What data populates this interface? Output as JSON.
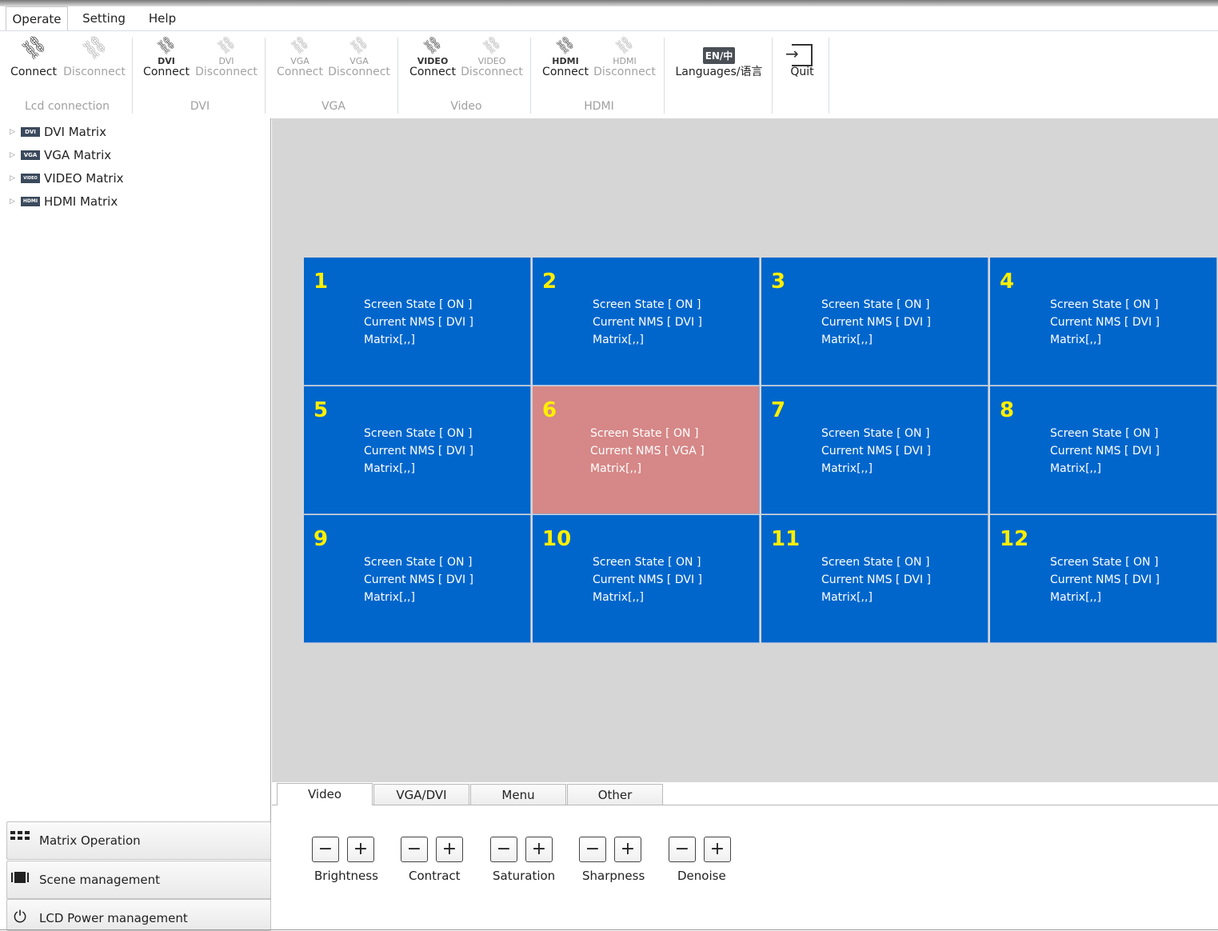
{
  "menubar": {
    "tabs": [
      "Operate",
      "Setting",
      "Help"
    ],
    "active": "Operate"
  },
  "ribbon": {
    "lcd": {
      "connect": "Connect",
      "disconnect": "Disconnect",
      "group": "Lcd connection"
    },
    "dvi": {
      "tag": "DVI",
      "connect": "Connect",
      "disconnect": "Disconnect",
      "group": "DVI"
    },
    "vga": {
      "tag": "VGA",
      "connect": "Connect",
      "disconnect": "Disconnect",
      "group": "VGA"
    },
    "video": {
      "tag": "VIDEO",
      "connect": "Connect",
      "disconnect": "Disconnect",
      "group": "Video"
    },
    "hdmi": {
      "tag": "HDMI",
      "connect": "Connect",
      "disconnect": "Disconnect",
      "group": "HDMI"
    },
    "languages": {
      "icon_text": "EN/中",
      "label": "Languages/语言"
    },
    "quit": {
      "label": "Quit"
    }
  },
  "tree": {
    "items": [
      {
        "badge": "DVI",
        "label": "DVI Matrix"
      },
      {
        "badge": "VGA",
        "label": "VGA Matrix"
      },
      {
        "badge": "VIDEO",
        "label": "VIDEO Matrix"
      },
      {
        "badge": "HDMI",
        "label": "HDMI Matrix"
      }
    ]
  },
  "nav": {
    "matrix_operation": "Matrix Operation",
    "scene_management": "Scene management",
    "lcd_power": "LCD Power management"
  },
  "wall": {
    "selected_tile": 6,
    "selected_color": "#d68787",
    "tile_color": "#0066cc",
    "number_color": "#ffef00",
    "tiles": [
      {
        "num": "1",
        "state": "Screen State [ ON ]",
        "nms": "Current NMS [ DVI ]",
        "matrix": "Matrix[,,]"
      },
      {
        "num": "2",
        "state": "Screen State [ ON ]",
        "nms": "Current NMS [ DVI ]",
        "matrix": "Matrix[,,]"
      },
      {
        "num": "3",
        "state": "Screen State [ ON ]",
        "nms": "Current NMS [ DVI ]",
        "matrix": "Matrix[,,]"
      },
      {
        "num": "4",
        "state": "Screen State [ ON ]",
        "nms": "Current NMS [ DVI ]",
        "matrix": "Matrix[,,]"
      },
      {
        "num": "5",
        "state": "Screen State [ ON ]",
        "nms": "Current NMS [ DVI ]",
        "matrix": "Matrix[,,]"
      },
      {
        "num": "6",
        "state": "Screen State [ ON ]",
        "nms": "Current NMS [ VGA ]",
        "matrix": "Matrix[,,]"
      },
      {
        "num": "7",
        "state": "Screen State [ ON ]",
        "nms": "Current NMS [ DVI ]",
        "matrix": "Matrix[,,]"
      },
      {
        "num": "8",
        "state": "Screen State [ ON ]",
        "nms": "Current NMS [ DVI ]",
        "matrix": "Matrix[,,]"
      },
      {
        "num": "9",
        "state": "Screen State [ ON ]",
        "nms": "Current NMS [ DVI ]",
        "matrix": "Matrix[,,]"
      },
      {
        "num": "10",
        "state": "Screen State [ ON ]",
        "nms": "Current NMS [ DVI ]",
        "matrix": "Matrix[,,]"
      },
      {
        "num": "11",
        "state": "Screen State [ ON ]",
        "nms": "Current NMS [ DVI ]",
        "matrix": "Matrix[,,]"
      },
      {
        "num": "12",
        "state": "Screen State [ ON ]",
        "nms": "Current NMS [ DVI ]",
        "matrix": "Matrix[,,]"
      }
    ]
  },
  "bottom": {
    "tabs": [
      "Video",
      "VGA/DVI",
      "Menu",
      "Other"
    ],
    "active_tab": "Video",
    "controls": [
      {
        "label": "Brightness",
        "minus": "−",
        "plus": "+"
      },
      {
        "label": "Contract",
        "minus": "−",
        "plus": "+"
      },
      {
        "label": "Saturation",
        "minus": "−",
        "plus": "+"
      },
      {
        "label": "Sharpness",
        "minus": "−",
        "plus": "+"
      },
      {
        "label": "Denoise",
        "minus": "−",
        "plus": "+"
      }
    ]
  }
}
